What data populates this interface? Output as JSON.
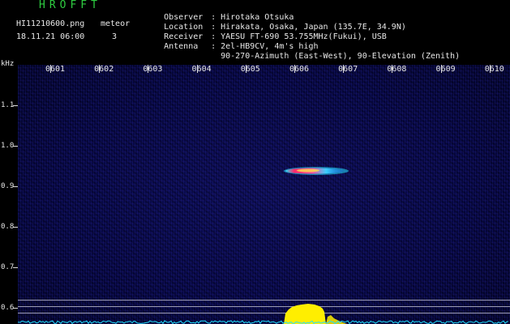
{
  "header": {
    "app_title": "HROFFT",
    "file_name": "HI11210600.png",
    "meteor_label": "meteor",
    "datetime": "18.11.21 06:00",
    "meteor_count": "3"
  },
  "info": {
    "separator": ":",
    "observer": {
      "label": "Observer",
      "value": "Hirotaka Otsuka"
    },
    "location": {
      "label": "Location",
      "value": "Hirakata, Osaka, Japan (135.7E, 34.9N)"
    },
    "receiver": {
      "label": "Receiver",
      "value": "YAESU FT-690 53.755MHz(Fukui), USB"
    },
    "antenna": {
      "label": "Antenna",
      "value": "2el-HB9CV, 4m's high",
      "value2": "90-270-Azimuth (East-West), 90-Elevation (Zenith)"
    }
  },
  "axes": {
    "unit": "kHz",
    "x_labels": [
      "0601",
      "0602",
      "0603",
      "0604",
      "0605",
      "0606",
      "0607",
      "0608",
      "0609",
      "0610"
    ],
    "y_labels": [
      "1.1",
      "1.0",
      "0.9",
      "0.8",
      "0.7",
      "0.6"
    ]
  },
  "colors": {
    "background": "#000000",
    "spectrogram": "#07074a",
    "title_green": "#2ecc40",
    "text": "#e8e8e8",
    "echo_core": "#ff2a6a",
    "echo_edge": "#22e0ff",
    "sun_noise": "#ffee00"
  }
}
